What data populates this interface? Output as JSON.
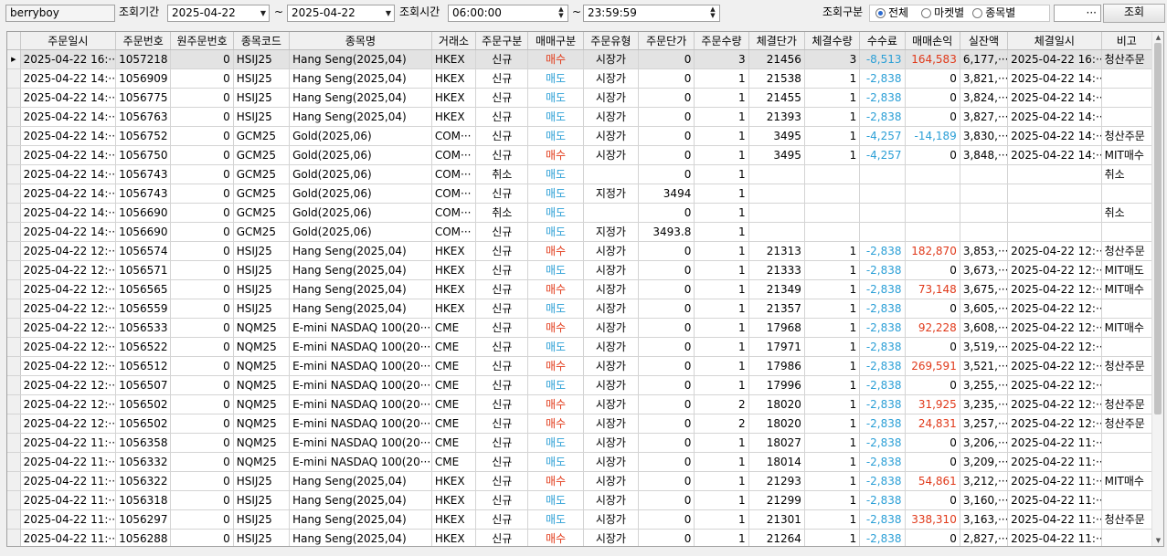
{
  "toolbar": {
    "account": "berryboy",
    "period_label": "조회기간",
    "date_from": "2025-04-22",
    "tilde": "~",
    "date_to": "2025-04-22",
    "time_label": "조회시간",
    "time_from": "06:00:00",
    "time_to": "23:59:59",
    "filter_label": "조회구분",
    "filter_options": [
      "전체",
      "마켓별",
      "종목별"
    ],
    "filter_selected": "전체",
    "ellipsis": "···",
    "search_button": "조회"
  },
  "columns": [
    "주문일시",
    "주문번호",
    "원주문번호",
    "종목코드",
    "종목명",
    "거래소",
    "주문구분",
    "매매구분",
    "주문유형",
    "주문단가",
    "주문수량",
    "체결단가",
    "체결수량",
    "수수료",
    "매매손익",
    "실잔액",
    "체결일시",
    "비고"
  ],
  "rows": [
    {
      "dt": "2025-04-22 16:···",
      "no": "1057218",
      "orig": "0",
      "code": "HSIJ25",
      "name": "Hang Seng(2025,04)",
      "ex": "HKEX",
      "kind": "신규",
      "side": "매수",
      "type": "시장가",
      "price": "0",
      "qty": "3",
      "fprice": "21456",
      "fqty": "3",
      "fee": "-8,513",
      "pnl": "164,583",
      "bal": "6,177,···",
      "fdt": "2025-04-22 16:···",
      "note": "청산주문"
    },
    {
      "dt": "2025-04-22 14:···",
      "no": "1056909",
      "orig": "0",
      "code": "HSIJ25",
      "name": "Hang Seng(2025,04)",
      "ex": "HKEX",
      "kind": "신규",
      "side": "매도",
      "type": "시장가",
      "price": "0",
      "qty": "1",
      "fprice": "21538",
      "fqty": "1",
      "fee": "-2,838",
      "pnl": "0",
      "bal": "3,821,···",
      "fdt": "2025-04-22 14:···",
      "note": ""
    },
    {
      "dt": "2025-04-22 14:···",
      "no": "1056775",
      "orig": "0",
      "code": "HSIJ25",
      "name": "Hang Seng(2025,04)",
      "ex": "HKEX",
      "kind": "신규",
      "side": "매도",
      "type": "시장가",
      "price": "0",
      "qty": "1",
      "fprice": "21455",
      "fqty": "1",
      "fee": "-2,838",
      "pnl": "0",
      "bal": "3,824,···",
      "fdt": "2025-04-22 14:···",
      "note": ""
    },
    {
      "dt": "2025-04-22 14:···",
      "no": "1056763",
      "orig": "0",
      "code": "HSIJ25",
      "name": "Hang Seng(2025,04)",
      "ex": "HKEX",
      "kind": "신규",
      "side": "매도",
      "type": "시장가",
      "price": "0",
      "qty": "1",
      "fprice": "21393",
      "fqty": "1",
      "fee": "-2,838",
      "pnl": "0",
      "bal": "3,827,···",
      "fdt": "2025-04-22 14:···",
      "note": ""
    },
    {
      "dt": "2025-04-22 14:···",
      "no": "1056752",
      "orig": "0",
      "code": "GCM25",
      "name": "Gold(2025,06)",
      "ex": "COM···",
      "kind": "신규",
      "side": "매도",
      "type": "시장가",
      "price": "0",
      "qty": "1",
      "fprice": "3495",
      "fqty": "1",
      "fee": "-4,257",
      "pnl": "-14,189",
      "bal": "3,830,···",
      "fdt": "2025-04-22 14:···",
      "note": "청산주문"
    },
    {
      "dt": "2025-04-22 14:···",
      "no": "1056750",
      "orig": "0",
      "code": "GCM25",
      "name": "Gold(2025,06)",
      "ex": "COM···",
      "kind": "신규",
      "side": "매수",
      "type": "시장가",
      "price": "0",
      "qty": "1",
      "fprice": "3495",
      "fqty": "1",
      "fee": "-4,257",
      "pnl": "0",
      "bal": "3,848,···",
      "fdt": "2025-04-22 14:···",
      "note": "MIT매수"
    },
    {
      "dt": "2025-04-22 14:···",
      "no": "1056743",
      "orig": "0",
      "code": "GCM25",
      "name": "Gold(2025,06)",
      "ex": "COM···",
      "kind": "취소",
      "side": "매도",
      "type": "",
      "price": "0",
      "qty": "1",
      "fprice": "",
      "fqty": "",
      "fee": "",
      "pnl": "",
      "bal": "",
      "fdt": "",
      "note": "취소"
    },
    {
      "dt": "2025-04-22 14:···",
      "no": "1056743",
      "orig": "0",
      "code": "GCM25",
      "name": "Gold(2025,06)",
      "ex": "COM···",
      "kind": "신규",
      "side": "매도",
      "type": "지정가",
      "price": "3494",
      "qty": "1",
      "fprice": "",
      "fqty": "",
      "fee": "",
      "pnl": "",
      "bal": "",
      "fdt": "",
      "note": ""
    },
    {
      "dt": "2025-04-22 14:···",
      "no": "1056690",
      "orig": "0",
      "code": "GCM25",
      "name": "Gold(2025,06)",
      "ex": "COM···",
      "kind": "취소",
      "side": "매도",
      "type": "",
      "price": "0",
      "qty": "1",
      "fprice": "",
      "fqty": "",
      "fee": "",
      "pnl": "",
      "bal": "",
      "fdt": "",
      "note": "취소"
    },
    {
      "dt": "2025-04-22 14:···",
      "no": "1056690",
      "orig": "0",
      "code": "GCM25",
      "name": "Gold(2025,06)",
      "ex": "COM···",
      "kind": "신규",
      "side": "매도",
      "type": "지정가",
      "price": "3493.8",
      "qty": "1",
      "fprice": "",
      "fqty": "",
      "fee": "",
      "pnl": "",
      "bal": "",
      "fdt": "",
      "note": ""
    },
    {
      "dt": "2025-04-22 12:···",
      "no": "1056574",
      "orig": "0",
      "code": "HSIJ25",
      "name": "Hang Seng(2025,04)",
      "ex": "HKEX",
      "kind": "신규",
      "side": "매수",
      "type": "시장가",
      "price": "0",
      "qty": "1",
      "fprice": "21313",
      "fqty": "1",
      "fee": "-2,838",
      "pnl": "182,870",
      "bal": "3,853,···",
      "fdt": "2025-04-22 12:···",
      "note": "청산주문"
    },
    {
      "dt": "2025-04-22 12:···",
      "no": "1056571",
      "orig": "0",
      "code": "HSIJ25",
      "name": "Hang Seng(2025,04)",
      "ex": "HKEX",
      "kind": "신규",
      "side": "매도",
      "type": "시장가",
      "price": "0",
      "qty": "1",
      "fprice": "21333",
      "fqty": "1",
      "fee": "-2,838",
      "pnl": "0",
      "bal": "3,673,···",
      "fdt": "2025-04-22 12:···",
      "note": "MIT매도"
    },
    {
      "dt": "2025-04-22 12:···",
      "no": "1056565",
      "orig": "0",
      "code": "HSIJ25",
      "name": "Hang Seng(2025,04)",
      "ex": "HKEX",
      "kind": "신규",
      "side": "매수",
      "type": "시장가",
      "price": "0",
      "qty": "1",
      "fprice": "21349",
      "fqty": "1",
      "fee": "-2,838",
      "pnl": "73,148",
      "bal": "3,675,···",
      "fdt": "2025-04-22 12:···",
      "note": "MIT매수"
    },
    {
      "dt": "2025-04-22 12:···",
      "no": "1056559",
      "orig": "0",
      "code": "HSIJ25",
      "name": "Hang Seng(2025,04)",
      "ex": "HKEX",
      "kind": "신규",
      "side": "매도",
      "type": "시장가",
      "price": "0",
      "qty": "1",
      "fprice": "21357",
      "fqty": "1",
      "fee": "-2,838",
      "pnl": "0",
      "bal": "3,605,···",
      "fdt": "2025-04-22 12:···",
      "note": ""
    },
    {
      "dt": "2025-04-22 12:···",
      "no": "1056533",
      "orig": "0",
      "code": "NQM25",
      "name": "E-mini NASDAQ 100(20···",
      "ex": "CME",
      "kind": "신규",
      "side": "매수",
      "type": "시장가",
      "price": "0",
      "qty": "1",
      "fprice": "17968",
      "fqty": "1",
      "fee": "-2,838",
      "pnl": "92,228",
      "bal": "3,608,···",
      "fdt": "2025-04-22 12:···",
      "note": "MIT매수"
    },
    {
      "dt": "2025-04-22 12:···",
      "no": "1056522",
      "orig": "0",
      "code": "NQM25",
      "name": "E-mini NASDAQ 100(20···",
      "ex": "CME",
      "kind": "신규",
      "side": "매도",
      "type": "시장가",
      "price": "0",
      "qty": "1",
      "fprice": "17971",
      "fqty": "1",
      "fee": "-2,838",
      "pnl": "0",
      "bal": "3,519,···",
      "fdt": "2025-04-22 12:···",
      "note": ""
    },
    {
      "dt": "2025-04-22 12:···",
      "no": "1056512",
      "orig": "0",
      "code": "NQM25",
      "name": "E-mini NASDAQ 100(20···",
      "ex": "CME",
      "kind": "신규",
      "side": "매수",
      "type": "시장가",
      "price": "0",
      "qty": "1",
      "fprice": "17986",
      "fqty": "1",
      "fee": "-2,838",
      "pnl": "269,591",
      "bal": "3,521,···",
      "fdt": "2025-04-22 12:···",
      "note": "청산주문"
    },
    {
      "dt": "2025-04-22 12:···",
      "no": "1056507",
      "orig": "0",
      "code": "NQM25",
      "name": "E-mini NASDAQ 100(20···",
      "ex": "CME",
      "kind": "신규",
      "side": "매도",
      "type": "시장가",
      "price": "0",
      "qty": "1",
      "fprice": "17996",
      "fqty": "1",
      "fee": "-2,838",
      "pnl": "0",
      "bal": "3,255,···",
      "fdt": "2025-04-22 12:···",
      "note": ""
    },
    {
      "dt": "2025-04-22 12:···",
      "no": "1056502",
      "orig": "0",
      "code": "NQM25",
      "name": "E-mini NASDAQ 100(20···",
      "ex": "CME",
      "kind": "신규",
      "side": "매수",
      "type": "시장가",
      "price": "0",
      "qty": "2",
      "fprice": "18020",
      "fqty": "1",
      "fee": "-2,838",
      "pnl": "31,925",
      "bal": "3,235,···",
      "fdt": "2025-04-22 12:···",
      "note": "청산주문"
    },
    {
      "dt": "2025-04-22 12:···",
      "no": "1056502",
      "orig": "0",
      "code": "NQM25",
      "name": "E-mini NASDAQ 100(20···",
      "ex": "CME",
      "kind": "신규",
      "side": "매수",
      "type": "시장가",
      "price": "0",
      "qty": "2",
      "fprice": "18020",
      "fqty": "1",
      "fee": "-2,838",
      "pnl": "24,831",
      "bal": "3,257,···",
      "fdt": "2025-04-22 12:···",
      "note": "청산주문"
    },
    {
      "dt": "2025-04-22 11:···",
      "no": "1056358",
      "orig": "0",
      "code": "NQM25",
      "name": "E-mini NASDAQ 100(20···",
      "ex": "CME",
      "kind": "신규",
      "side": "매도",
      "type": "시장가",
      "price": "0",
      "qty": "1",
      "fprice": "18027",
      "fqty": "1",
      "fee": "-2,838",
      "pnl": "0",
      "bal": "3,206,···",
      "fdt": "2025-04-22 11:···",
      "note": ""
    },
    {
      "dt": "2025-04-22 11:···",
      "no": "1056332",
      "orig": "0",
      "code": "NQM25",
      "name": "E-mini NASDAQ 100(20···",
      "ex": "CME",
      "kind": "신규",
      "side": "매도",
      "type": "시장가",
      "price": "0",
      "qty": "1",
      "fprice": "18014",
      "fqty": "1",
      "fee": "-2,838",
      "pnl": "0",
      "bal": "3,209,···",
      "fdt": "2025-04-22 11:···",
      "note": ""
    },
    {
      "dt": "2025-04-22 11:···",
      "no": "1056322",
      "orig": "0",
      "code": "HSIJ25",
      "name": "Hang Seng(2025,04)",
      "ex": "HKEX",
      "kind": "신규",
      "side": "매수",
      "type": "시장가",
      "price": "0",
      "qty": "1",
      "fprice": "21293",
      "fqty": "1",
      "fee": "-2,838",
      "pnl": "54,861",
      "bal": "3,212,···",
      "fdt": "2025-04-22 11:···",
      "note": "MIT매수"
    },
    {
      "dt": "2025-04-22 11:···",
      "no": "1056318",
      "orig": "0",
      "code": "HSIJ25",
      "name": "Hang Seng(2025,04)",
      "ex": "HKEX",
      "kind": "신규",
      "side": "매도",
      "type": "시장가",
      "price": "0",
      "qty": "1",
      "fprice": "21299",
      "fqty": "1",
      "fee": "-2,838",
      "pnl": "0",
      "bal": "3,160,···",
      "fdt": "2025-04-22 11:···",
      "note": ""
    },
    {
      "dt": "2025-04-22 11:···",
      "no": "1056297",
      "orig": "0",
      "code": "HSIJ25",
      "name": "Hang Seng(2025,04)",
      "ex": "HKEX",
      "kind": "신규",
      "side": "매도",
      "type": "시장가",
      "price": "0",
      "qty": "1",
      "fprice": "21301",
      "fqty": "1",
      "fee": "-2,838",
      "pnl": "338,310",
      "bal": "3,163,···",
      "fdt": "2025-04-22 11:···",
      "note": "청산주문"
    },
    {
      "dt": "2025-04-22 11:···",
      "no": "1056288",
      "orig": "0",
      "code": "HSIJ25",
      "name": "Hang Seng(2025,04)",
      "ex": "HKEX",
      "kind": "신규",
      "side": "매수",
      "type": "시장가",
      "price": "0",
      "qty": "1",
      "fprice": "21264",
      "fqty": "1",
      "fee": "-2,838",
      "pnl": "0",
      "bal": "2,827,···",
      "fdt": "2025-04-22 11:···",
      "note": ""
    }
  ],
  "selected_row": 0,
  "colors": {
    "buy": "#e23b1a",
    "sell": "#2b9fd6",
    "fee": "#2b9fd6",
    "profit": "#e0391a"
  }
}
